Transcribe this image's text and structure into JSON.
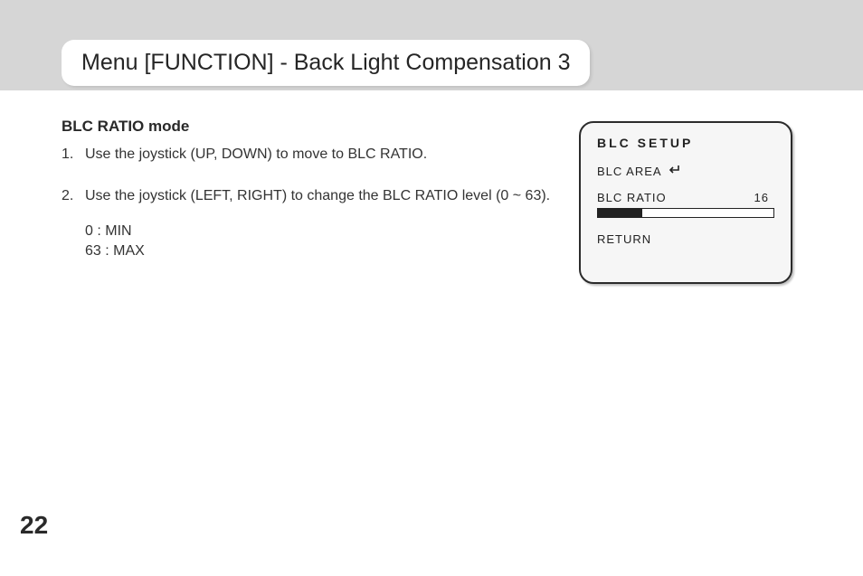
{
  "header": {
    "title": "Menu [FUNCTION] - Back Light Compensation 3"
  },
  "section": {
    "subhead": "BLC RATIO mode",
    "steps": [
      {
        "num": "1.",
        "text": "Use the joystick (UP, DOWN) to move to BLC RATIO."
      },
      {
        "num": "2.",
        "text": "Use the joystick (LEFT, RIGHT) to change the BLC RATIO level (0 ~ 63).",
        "extra": [
          "0 : MIN",
          "63 : MAX"
        ]
      }
    ]
  },
  "osd": {
    "title": "BLC SETUP",
    "area_label": "BLC AREA",
    "ratio_label": "BLC RATIO",
    "ratio_value": "16",
    "ratio_min": 0,
    "ratio_max": 63,
    "progress_percent": 25.4,
    "return_label": "RETURN"
  },
  "page_number": "22"
}
